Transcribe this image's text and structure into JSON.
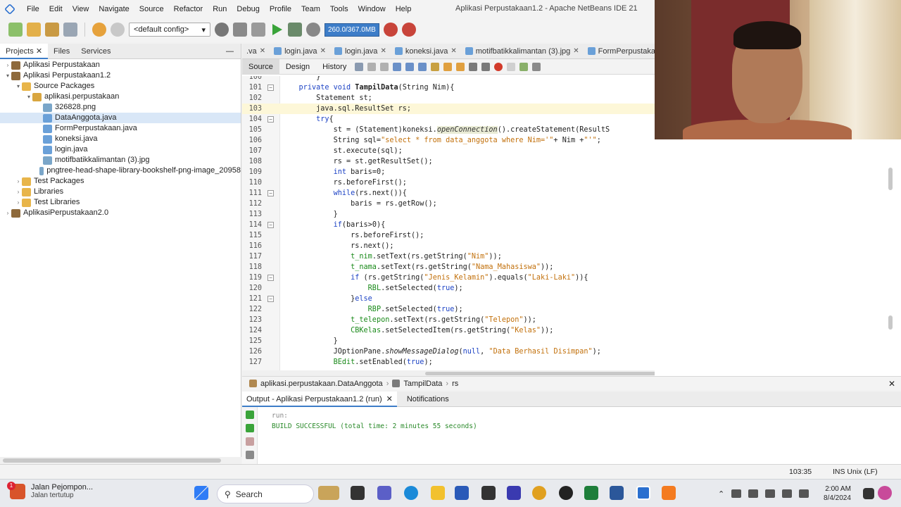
{
  "window": {
    "title": "Aplikasi Perpustakaan1.2 - Apache NetBeans IDE 21",
    "menu": [
      "File",
      "Edit",
      "View",
      "Navigate",
      "Source",
      "Refactor",
      "Run",
      "Debug",
      "Profile",
      "Team",
      "Tools",
      "Window",
      "Help"
    ]
  },
  "toolbar": {
    "config": "<default config>",
    "memory": "260.0/367.0MB"
  },
  "left_panel": {
    "tabs": [
      "Projects",
      "Files",
      "Services"
    ],
    "tree": [
      {
        "label": "Aplikasi Perpustakaan",
        "depth": 0,
        "icon": "project-icon",
        "expanded": false
      },
      {
        "label": "Aplikasi Perpustakaan1.2",
        "depth": 0,
        "icon": "project-icon",
        "expanded": true
      },
      {
        "label": "Source Packages",
        "depth": 1,
        "icon": "folder-icon",
        "expanded": true
      },
      {
        "label": "aplikasi.perpustakaan",
        "depth": 2,
        "icon": "package-icon",
        "expanded": true
      },
      {
        "label": "326828.png",
        "depth": 3,
        "icon": "image-file-icon"
      },
      {
        "label": "DataAnggota.java",
        "depth": 3,
        "icon": "java-file-icon",
        "selected": true
      },
      {
        "label": "FormPerpustakaan.java",
        "depth": 3,
        "icon": "java-file-icon"
      },
      {
        "label": "koneksi.java",
        "depth": 3,
        "icon": "java-file-icon"
      },
      {
        "label": "login.java",
        "depth": 3,
        "icon": "java-file-icon"
      },
      {
        "label": "motifbatikkalimantan (3).jpg",
        "depth": 3,
        "icon": "image-file-icon"
      },
      {
        "label": "pngtree-head-shape-library-bookshelf-png-image_20958",
        "depth": 3,
        "icon": "image-file-icon"
      },
      {
        "label": "Test Packages",
        "depth": 1,
        "icon": "folder-icon",
        "expanded": false
      },
      {
        "label": "Libraries",
        "depth": 1,
        "icon": "folder-icon",
        "expanded": false
      },
      {
        "label": "Test Libraries",
        "depth": 1,
        "icon": "folder-icon",
        "expanded": false
      },
      {
        "label": "AplikasiPerpustakaan2.0",
        "depth": 0,
        "icon": "project-icon",
        "expanded": false
      }
    ]
  },
  "editor": {
    "tabs": [
      ".va",
      "login.java",
      "login.java",
      "koneksi.java",
      "motifbatikkalimantan (3).jpg",
      "FormPerpustakaan.java"
    ],
    "views": [
      "Source",
      "Design",
      "History"
    ],
    "active_view": "Source",
    "first_line": 100,
    "current_line": 103,
    "lines": [
      {
        "n": "100",
        "html": "        }"
      },
      {
        "n": "101",
        "fold": true,
        "html": "    <span class=\"kw\">private void</span> <b>TampilData</b>(String Nim){"
      },
      {
        "n": "102",
        "html": "        Statement st;"
      },
      {
        "n": "103",
        "html": "        java.sql.ResultSet rs;"
      },
      {
        "n": "104",
        "fold": true,
        "html": "        <span class=\"kw\">try</span>{"
      },
      {
        "n": "105",
        "html": "            st = (Statement)koneksi.<span class=\"mth\">openConnection</span>().createStatement(ResultS"
      },
      {
        "n": "106",
        "html": "            String sql=<span class=\"str\">\"select * from data_anggota where Nim='\"</span>+ Nim +<span class=\"str\">\"'\"</span>;"
      },
      {
        "n": "107",
        "html": "            st.execute(sql);"
      },
      {
        "n": "108",
        "html": "            rs = st.getResultSet();"
      },
      {
        "n": "109",
        "html": "            <span class=\"kw\">int</span> baris=0;"
      },
      {
        "n": "110",
        "html": "            rs.beforeFirst();"
      },
      {
        "n": "111",
        "fold": true,
        "html": "            <span class=\"kw\">while</span>(rs.next()){"
      },
      {
        "n": "112",
        "html": "                baris = rs.getRow();"
      },
      {
        "n": "113",
        "html": "            }"
      },
      {
        "n": "114",
        "fold": true,
        "html": "            <span class=\"kw\">if</span>(baris>0){"
      },
      {
        "n": "115",
        "html": "                rs.beforeFirst();"
      },
      {
        "n": "116",
        "html": "                rs.next();"
      },
      {
        "n": "117",
        "html": "                <span class=\"fld\">t_nim</span>.setText(rs.getString(<span class=\"str\">\"Nim\"</span>));"
      },
      {
        "n": "118",
        "html": "                <span class=\"fld\">t_nama</span>.setText(rs.getString(<span class=\"str\">\"Nama_Mahasiswa\"</span>));"
      },
      {
        "n": "119",
        "fold": true,
        "html": "                <span class=\"kw\">if</span> (rs.getString(<span class=\"str\">\"Jenis_Kelamin\"</span>).equals(<span class=\"str\">\"Laki-Laki\"</span>)){"
      },
      {
        "n": "120",
        "html": "                    <span class=\"fld\">RBL</span>.setSelected(<span class=\"kw\">true</span>);"
      },
      {
        "n": "121",
        "fold": true,
        "html": "                }<span class=\"kw\">else</span>"
      },
      {
        "n": "122",
        "html": "                    <span class=\"fld\">RBP</span>.setSelected(<span class=\"kw\">true</span>);"
      },
      {
        "n": "123",
        "html": "                <span class=\"fld\">t_telepon</span>.setText(rs.getString(<span class=\"str\">\"Telepon\"</span>));"
      },
      {
        "n": "124",
        "html": "                <span class=\"fld\">CBKelas</span>.setSelectedItem(rs.getString(<span class=\"str\">\"Kelas\"</span>));"
      },
      {
        "n": "125",
        "html": "            }"
      },
      {
        "n": "126",
        "html": "            JOptionPane.<span class=\"ital\">showMessageDialog</span>(<span class=\"kw\">null</span>, <span class=\"str\">\"Data Berhasil Disimpan\"</span>);"
      },
      {
        "n": "127",
        "html": "            <span class=\"fld\">BEdit</span>.setEnabled(<span class=\"kw\">true</span>);"
      }
    ]
  },
  "breadcrumb": [
    "aplikasi.perpustakaan.DataAnggota",
    "TampilData",
    "rs"
  ],
  "output": {
    "tabs": [
      "Output - Aplikasi Perpustakaan1.2 (run)",
      "Notifications"
    ],
    "run": "run:",
    "result": "BUILD SUCCESSFUL (total time: 2 minutes 55 seconds)"
  },
  "status": {
    "position": "103:35",
    "mode": "INS  Unix (LF)"
  },
  "taskbar": {
    "weather_badge": "1",
    "weather_title": "Jalan Pejompon...",
    "weather_sub": "Jalan tertutup",
    "search": "Search",
    "time": "2:00 AM",
    "date": "8/4/2024"
  }
}
